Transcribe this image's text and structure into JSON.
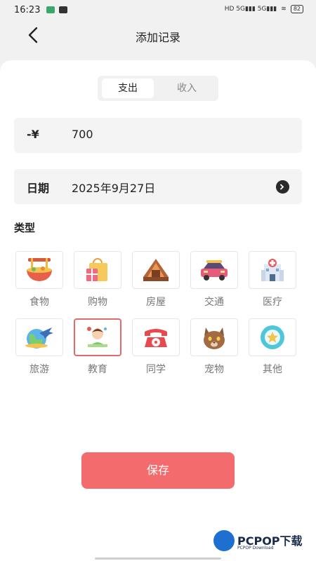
{
  "status_bar": {
    "time": "16:23",
    "battery": "82"
  },
  "header": {
    "title": "添加记录"
  },
  "tabs": [
    {
      "label": "支出",
      "active": true
    },
    {
      "label": "收入",
      "active": false
    }
  ],
  "amount": {
    "prefix": "-¥",
    "value": "700"
  },
  "date": {
    "label": "日期",
    "value": "2025年9月27日"
  },
  "category": {
    "title": "类型",
    "selected": "教育",
    "items": [
      {
        "label": "食物",
        "icon": "noodle-bowl-icon"
      },
      {
        "label": "购物",
        "icon": "shopping-bag-icon"
      },
      {
        "label": "房屋",
        "icon": "house-icon"
      },
      {
        "label": "交通",
        "icon": "car-icon"
      },
      {
        "label": "医疗",
        "icon": "hospital-icon"
      },
      {
        "label": "旅游",
        "icon": "airplane-globe-icon"
      },
      {
        "label": "教育",
        "icon": "student-icon"
      },
      {
        "label": "同学",
        "icon": "telephone-icon"
      },
      {
        "label": "宠物",
        "icon": "cat-icon"
      },
      {
        "label": "其他",
        "icon": "star-badge-icon"
      }
    ]
  },
  "save_button": {
    "label": "保存"
  },
  "watermark": {
    "text": "PCPOP下载",
    "sub": "PCPOP Download"
  },
  "colors": {
    "accent": "#f46b6d",
    "selected_border": "#e36b6b",
    "background": "#f1f1f1"
  }
}
